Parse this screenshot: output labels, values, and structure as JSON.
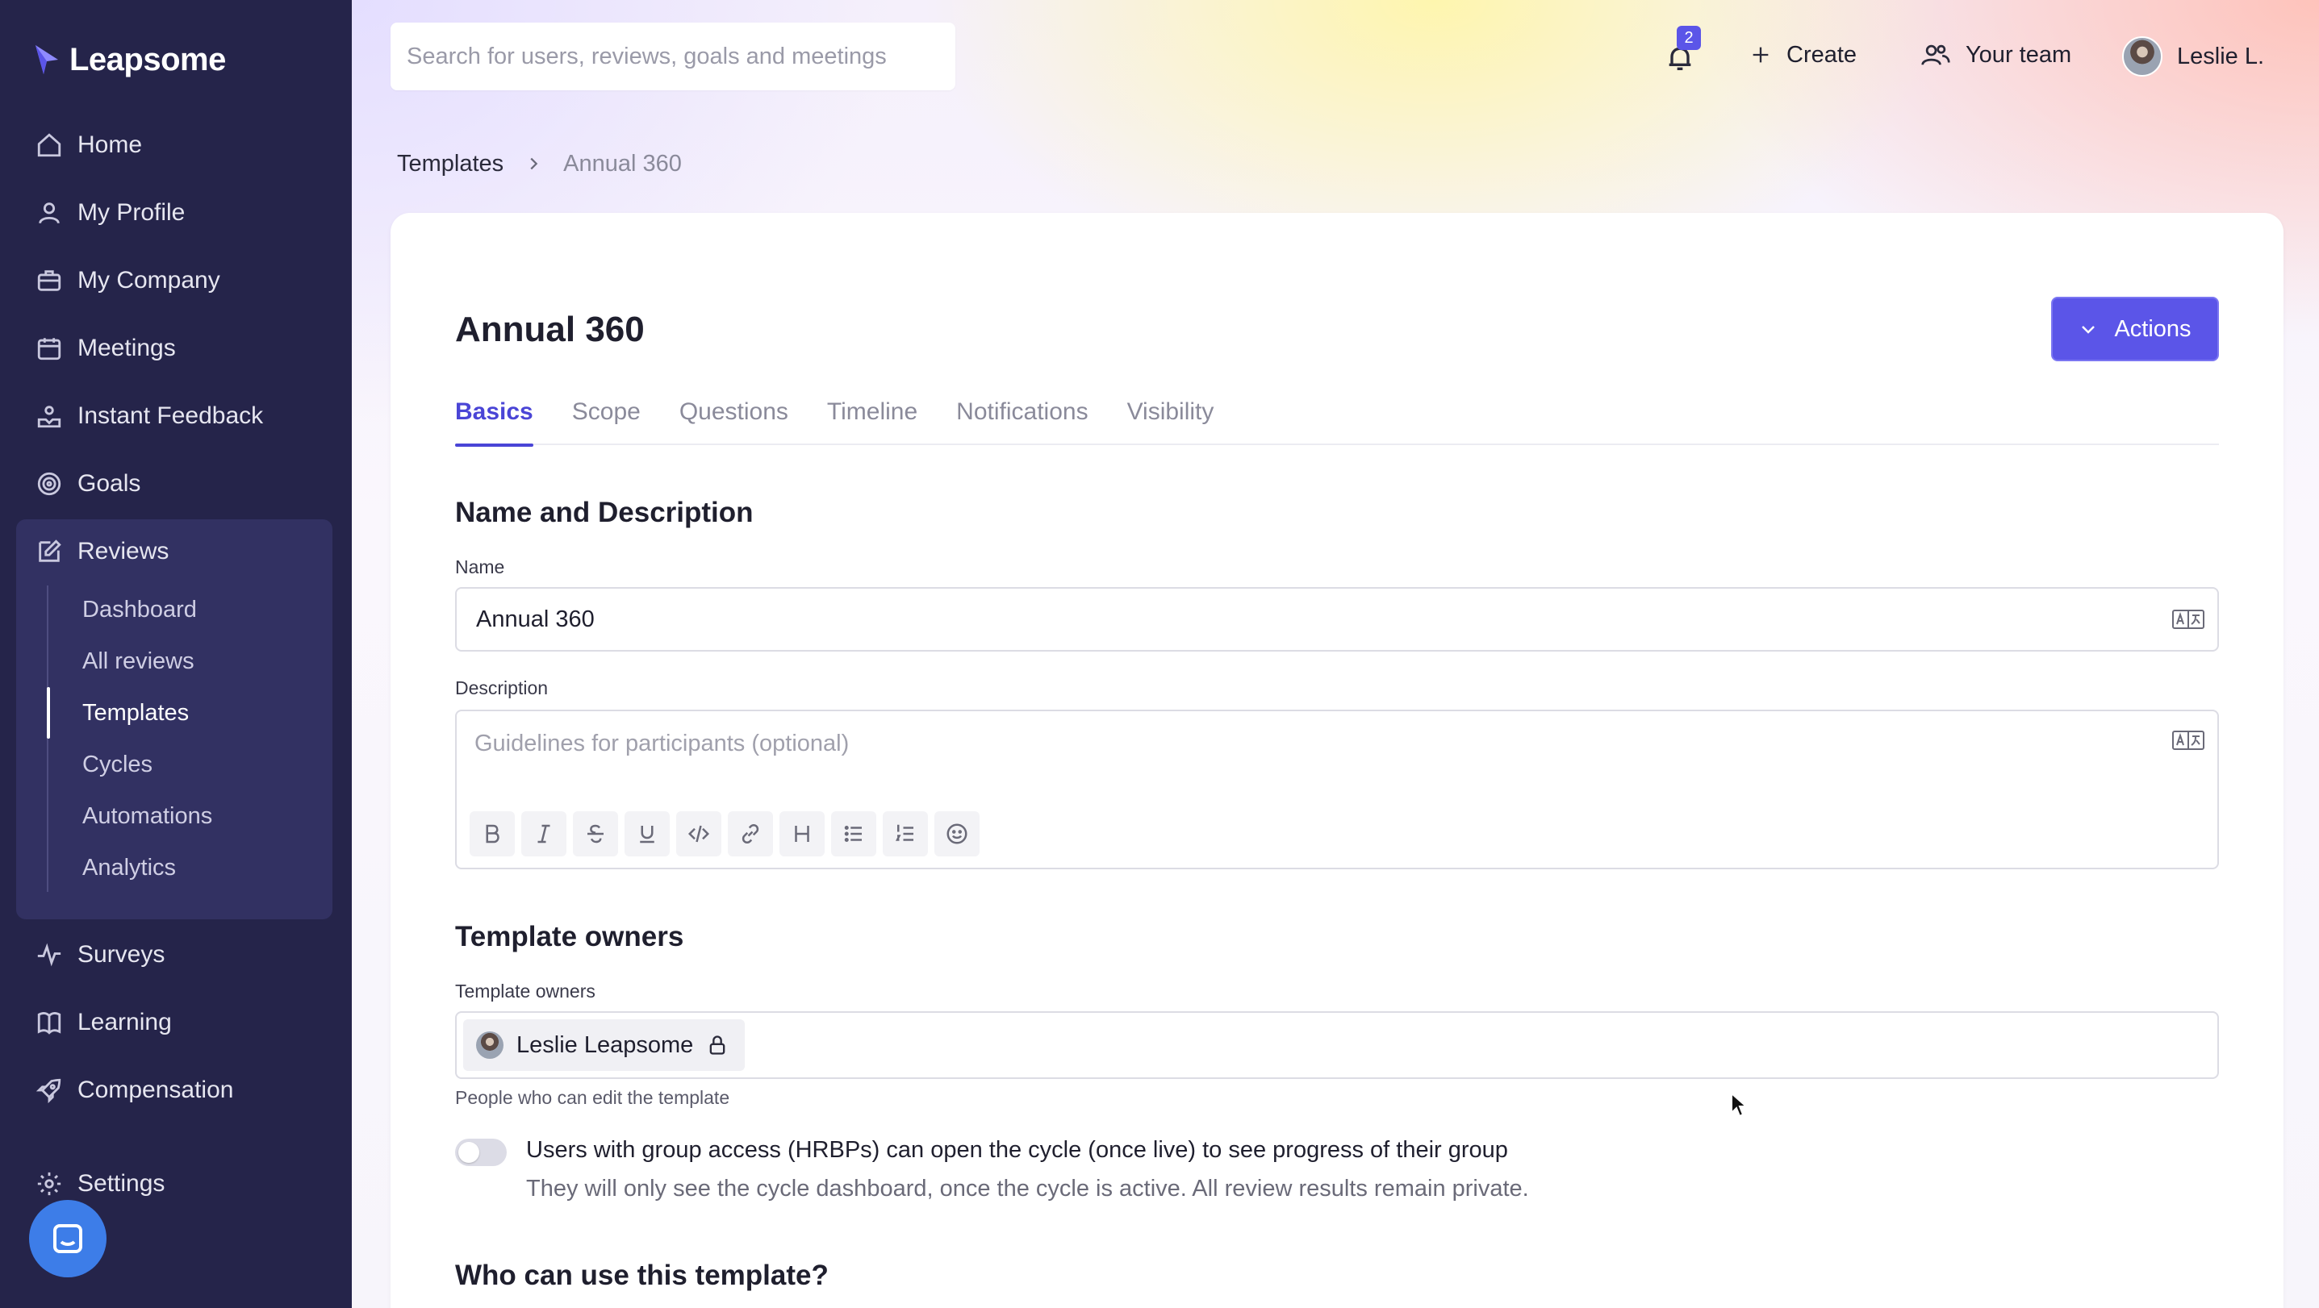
{
  "app": {
    "name": "Leapsome"
  },
  "sidebar": {
    "items": [
      {
        "label": "Home",
        "icon": "home-icon"
      },
      {
        "label": "My Profile",
        "icon": "user-icon"
      },
      {
        "label": "My Company",
        "icon": "briefcase-icon"
      },
      {
        "label": "Meetings",
        "icon": "calendar-icon"
      },
      {
        "label": "Instant Feedback",
        "icon": "feedback-icon"
      },
      {
        "label": "Goals",
        "icon": "target-icon"
      },
      {
        "label": "Reviews",
        "icon": "edit-icon"
      },
      {
        "label": "Surveys",
        "icon": "pulse-icon"
      },
      {
        "label": "Learning",
        "icon": "book-icon"
      },
      {
        "label": "Compensation",
        "icon": "rocket-icon"
      },
      {
        "label": "Settings",
        "icon": "gear-icon"
      }
    ],
    "reviews_sub": [
      "Dashboard",
      "All reviews",
      "Templates",
      "Cycles",
      "Automations",
      "Analytics"
    ],
    "active_sub": "Templates"
  },
  "header": {
    "search_placeholder": "Search for users, reviews, goals and meetings",
    "notifications_count": "2",
    "create_label": "Create",
    "team_label": "Your team",
    "user_label": "Leslie L."
  },
  "breadcrumb": {
    "parent": "Templates",
    "current": "Annual 360"
  },
  "page": {
    "title": "Annual 360",
    "actions_label": "Actions",
    "tabs": [
      "Basics",
      "Scope",
      "Questions",
      "Timeline",
      "Notifications",
      "Visibility"
    ],
    "active_tab": "Basics"
  },
  "form": {
    "name_section_title": "Name and Description",
    "name_label": "Name",
    "name_value": "Annual 360",
    "description_label": "Description",
    "description_placeholder": "Guidelines for participants (optional)",
    "owners_section_title": "Template owners",
    "owners_label": "Template owners",
    "owner_name": "Leslie Leapsome",
    "owners_helper": "People who can edit the template",
    "group_access_label": "Users with group access (HRBPs) can open the cycle (once live) to see progress of their group",
    "group_access_sub": "They will only see the cycle dashboard, once the cycle is active. All review results remain private.",
    "group_access_enabled": false,
    "usage_section_title": "Who can use this template?"
  },
  "colors": {
    "sidebar_bg": "#25244a",
    "accent": "#5b55e8",
    "tab_active": "#4a45d6"
  }
}
